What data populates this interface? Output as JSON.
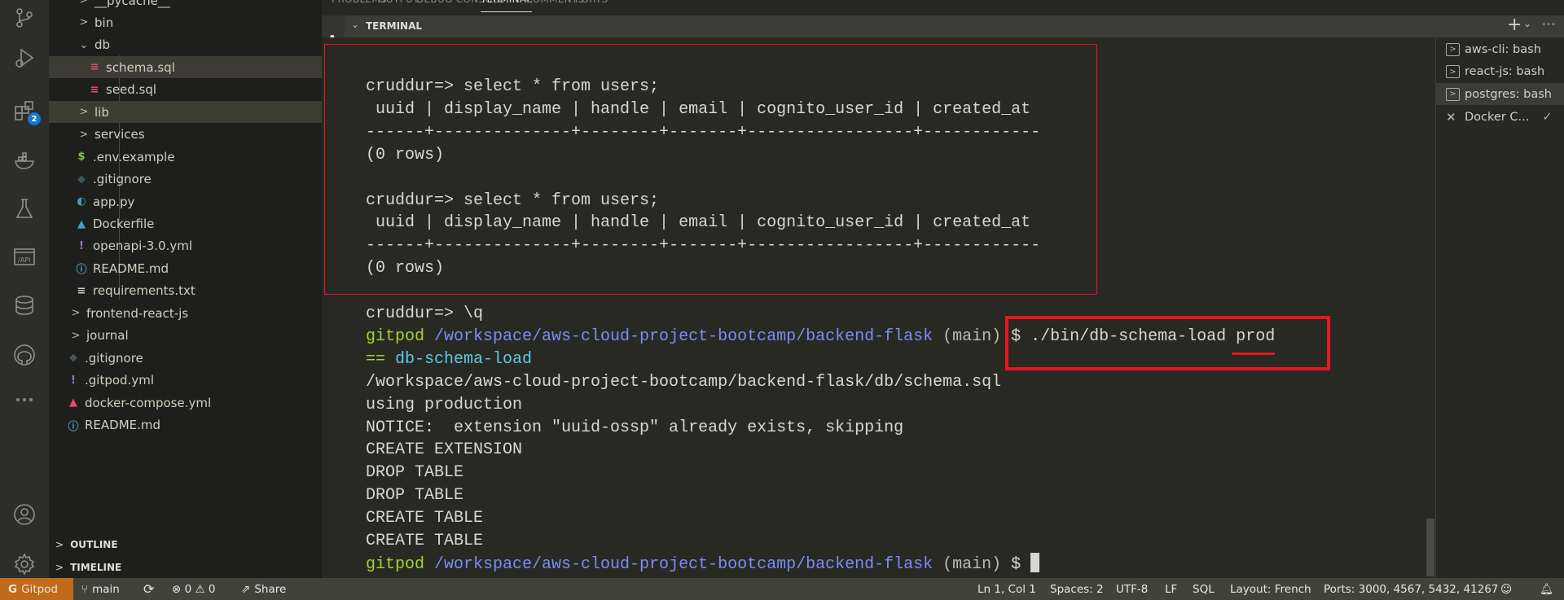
{
  "activity_bar": {
    "items": [
      "source-control-icon",
      "run-debug-icon",
      "extensions-icon",
      "docker-icon",
      "testing-icon",
      "api-icon",
      "database-icon",
      "github-icon",
      "more-icon",
      "account-icon",
      "settings-gear-icon"
    ],
    "extensions_badge": "2"
  },
  "explorer": {
    "items": [
      {
        "label": "__pycache__",
        "type": "folder",
        "open": false,
        "depth": 1
      },
      {
        "label": "bin",
        "type": "folder",
        "open": false,
        "depth": 1
      },
      {
        "label": "db",
        "type": "folder",
        "open": true,
        "depth": 1
      },
      {
        "label": "schema.sql",
        "type": "sql",
        "depth": 2,
        "selected": true
      },
      {
        "label": "seed.sql",
        "type": "sql",
        "depth": 2
      },
      {
        "label": "lib",
        "type": "folder",
        "open": false,
        "depth": 1,
        "selected": true
      },
      {
        "label": "services",
        "type": "folder",
        "open": false,
        "depth": 1
      },
      {
        "label": ".env.example",
        "type": "env",
        "depth": 1
      },
      {
        "label": ".gitignore",
        "type": "git",
        "depth": 1
      },
      {
        "label": "app.py",
        "type": "python",
        "depth": 1
      },
      {
        "label": "Dockerfile",
        "type": "docker",
        "depth": 1
      },
      {
        "label": "openapi-3.0.yml",
        "type": "yaml",
        "depth": 1
      },
      {
        "label": "README.md",
        "type": "info",
        "depth": 1
      },
      {
        "label": "requirements.txt",
        "type": "text",
        "depth": 1
      },
      {
        "label": "frontend-react-js",
        "type": "folder",
        "open": false,
        "depth": 0
      },
      {
        "label": "journal",
        "type": "folder",
        "open": false,
        "depth": 0
      },
      {
        "label": ".gitignore",
        "type": "git",
        "depth": 0
      },
      {
        "label": ".gitpod.yml",
        "type": "yaml",
        "depth": 0
      },
      {
        "label": "docker-compose.yml",
        "type": "compose",
        "depth": 0
      },
      {
        "label": "README.md",
        "type": "info",
        "depth": 0
      }
    ],
    "outline": "OUTLINE",
    "timeline": "TIMELINE"
  },
  "panel": {
    "tabs": [
      "PROBLEMS",
      "OUTPUT",
      "DEBUG CONSOLE",
      "TERMINAL",
      "COMMENTS",
      "PORTS"
    ],
    "active_tab": "TERMINAL",
    "section_title": "TERMINAL"
  },
  "terminal": {
    "lines": [
      [
        {
          "t": "cruddur=> select * from users;"
        }
      ],
      [
        {
          "t": " uuid | display_name | handle | email | cognito_user_id | created_at"
        }
      ],
      [
        {
          "t": "------+--------------+--------+-------+-----------------+------------"
        }
      ],
      [
        {
          "t": "(0 rows)"
        }
      ],
      [],
      [
        {
          "t": "cruddur=> select * from users;"
        }
      ],
      [
        {
          "t": " uuid | display_name | handle | email | cognito_user_id | created_at"
        }
      ],
      [
        {
          "t": "------+--------------+--------+-------+-----------------+------------"
        }
      ],
      [
        {
          "t": "(0 rows)"
        }
      ],
      [],
      [
        {
          "t": "cruddur=> \\q"
        }
      ],
      [
        {
          "t": "gitpod ",
          "c": "green"
        },
        {
          "t": "/workspace/aws-cloud-project-bootcamp/backend-flask ",
          "c": "blue"
        },
        {
          "t": "(main) ",
          "c": "gray"
        },
        {
          "t": "$ ./bin/db-schema-load prod"
        }
      ],
      [
        {
          "t": "== ",
          "c": "green"
        },
        {
          "t": "db-schema-load",
          "c": "cyan"
        }
      ],
      [
        {
          "t": "/workspace/aws-cloud-project-bootcamp/backend-flask/db/schema.sql"
        }
      ],
      [
        {
          "t": "using production"
        }
      ],
      [
        {
          "t": "NOTICE:  extension \"uuid-ossp\" already exists, skipping"
        }
      ],
      [
        {
          "t": "CREATE EXTENSION"
        }
      ],
      [
        {
          "t": "DROP TABLE"
        }
      ],
      [
        {
          "t": "DROP TABLE"
        }
      ],
      [
        {
          "t": "CREATE TABLE"
        }
      ],
      [
        {
          "t": "CREATE TABLE"
        }
      ],
      [
        {
          "t": "gitpod ",
          "c": "green"
        },
        {
          "t": "/workspace/aws-cloud-project-bootcamp/backend-flask ",
          "c": "blue"
        },
        {
          "t": "(main) ",
          "c": "gray"
        },
        {
          "t": "$ "
        }
      ]
    ],
    "instances": [
      {
        "label": "aws-cli: bash",
        "icon": "terminal-icon"
      },
      {
        "label": "react-js: bash",
        "icon": "terminal-icon"
      },
      {
        "label": "postgres: bash",
        "icon": "terminal-icon",
        "selected": true
      },
      {
        "label": "Docker C...",
        "icon": "tools-icon",
        "check": "✓"
      }
    ]
  },
  "status_bar": {
    "remote": "Gitpod",
    "branch": "main",
    "errors": "0",
    "warnings": "0",
    "share": "Share",
    "position": "Ln 1, Col 1",
    "indent": "Spaces: 2",
    "encoding": "UTF-8",
    "eol": "LF",
    "language": "SQL",
    "layout": "Layout: French",
    "ports": "Ports: 3000, 4567, 5432, 41267"
  },
  "colors": {
    "annotation_red": "#e8161f",
    "gitpod_orange": "#c06a1b",
    "prompt_green": "#a6d22e",
    "path_blue": "#7c8cf8"
  }
}
